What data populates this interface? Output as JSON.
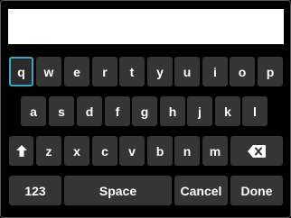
{
  "input": {
    "value": "",
    "placeholder": ""
  },
  "keyboard": {
    "row1": [
      "q",
      "w",
      "e",
      "r",
      "t",
      "y",
      "u",
      "i",
      "o",
      "p"
    ],
    "row2": [
      "a",
      "s",
      "d",
      "f",
      "g",
      "h",
      "j",
      "k",
      "l"
    ],
    "row3": [
      "z",
      "x",
      "c",
      "v",
      "b",
      "n",
      "m"
    ],
    "shift_icon": "shift-icon",
    "backspace_icon": "backspace-icon",
    "numbers_label": "123",
    "space_label": "Space",
    "cancel_label": "Cancel",
    "done_label": "Done",
    "focused_key": "q"
  },
  "colors": {
    "background": "#000000",
    "key": "#353535",
    "focus_ring": "#39a6c9",
    "input": "#ffffff"
  }
}
